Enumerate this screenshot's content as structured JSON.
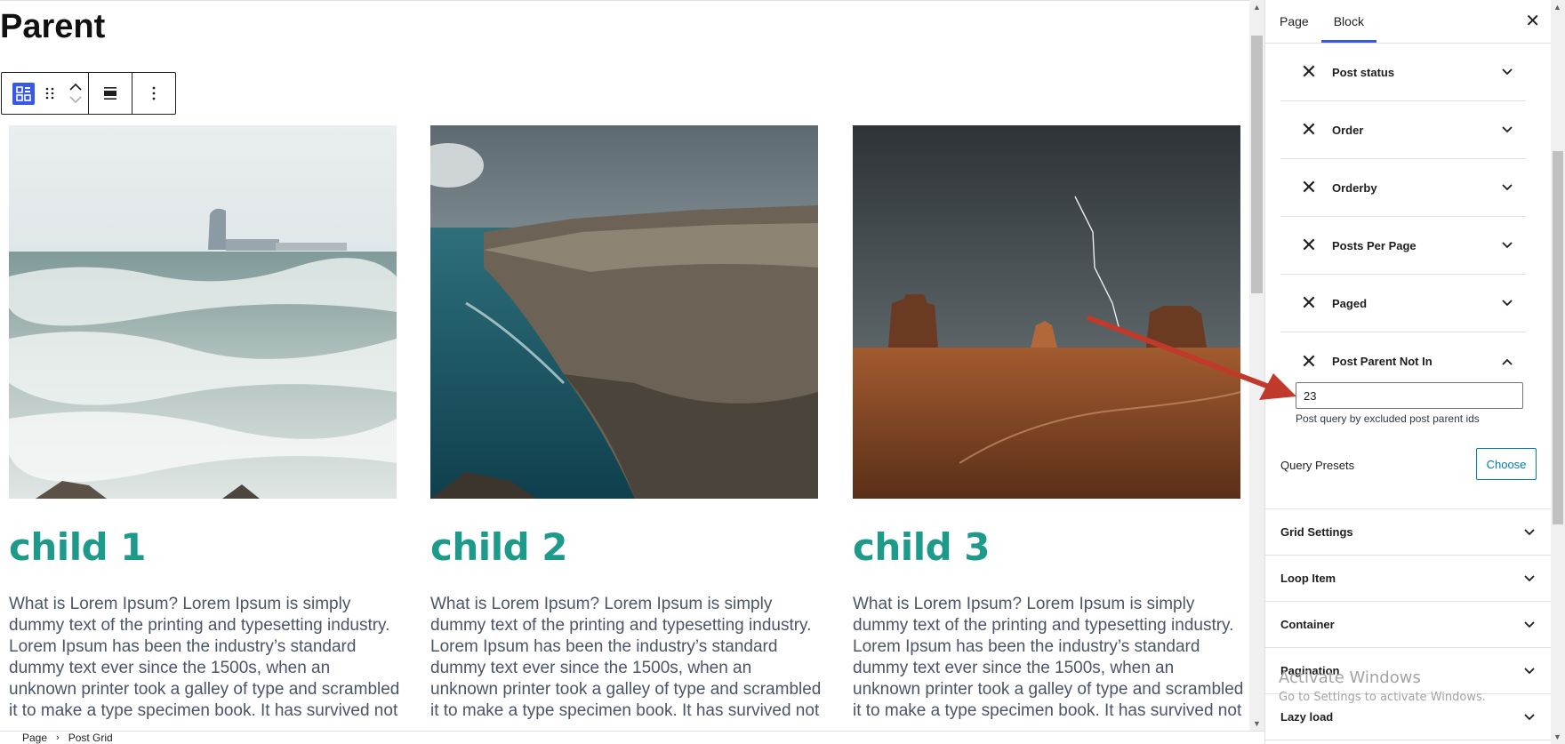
{
  "page": {
    "title": "Parent"
  },
  "toolbar": {
    "block_icon": "grid-block-icon",
    "drag_icon": "drag-handle-icon",
    "move_up_icon": "chevron-up-icon",
    "move_down_icon": "chevron-down-icon",
    "align_icon": "align-icon",
    "more_icon": "more-vertical-icon"
  },
  "posts": [
    {
      "title": "child 1",
      "excerpt": "What is Lorem Ipsum? Lorem Ipsum is simply dummy text of the printing and typesetting industry. Lorem Ipsum has been the industry’s standard dummy text ever since the 1500s, when an unknown printer took a galley of type and scrambled it to make a type specimen book. It has survived not"
    },
    {
      "title": "child 2",
      "excerpt": "What is Lorem Ipsum? Lorem Ipsum is simply dummy text of the printing and typesetting industry. Lorem Ipsum has been the industry’s standard dummy text ever since the 1500s, when an unknown printer took a galley of type and scrambled it to make a type specimen book. It has survived not"
    },
    {
      "title": "child 3",
      "excerpt": "What is Lorem Ipsum? Lorem Ipsum is simply dummy text of the printing and typesetting industry. Lorem Ipsum has been the industry’s standard dummy text ever since the 1500s, when an unknown printer took a galley of type and scrambled it to make a type specimen book. It has survived not"
    }
  ],
  "sidebar": {
    "tabs": [
      {
        "label": "Page",
        "active": false
      },
      {
        "label": "Block",
        "active": true
      }
    ],
    "close_icon": "close-icon",
    "query_items": [
      {
        "label": "Post status",
        "expanded": false
      },
      {
        "label": "Order",
        "expanded": false
      },
      {
        "label": "Orderby",
        "expanded": false
      },
      {
        "label": "Posts Per Page",
        "expanded": false
      },
      {
        "label": "Paged",
        "expanded": false
      },
      {
        "label": "Post Parent Not In",
        "expanded": true
      }
    ],
    "post_parent_not_in": {
      "value": "23",
      "help": "Post query by excluded post parent ids"
    },
    "query_presets": {
      "label": "Query Presets",
      "button": "Choose"
    },
    "panels": [
      {
        "label": "Grid Settings"
      },
      {
        "label": "Loop Item"
      },
      {
        "label": "Container"
      },
      {
        "label": "Pagination"
      },
      {
        "label": "Lazy load"
      }
    ]
  },
  "watermark": {
    "title": "Activate Windows",
    "subtitle": "Go to Settings to activate Windows."
  },
  "breadcrumb": [
    "Page",
    "Post Grid"
  ],
  "colors": {
    "accent": "#3858e9",
    "post_title": "#1e9a8a",
    "annotation_arrow": "#c0392b",
    "button_outline": "#007cba"
  }
}
